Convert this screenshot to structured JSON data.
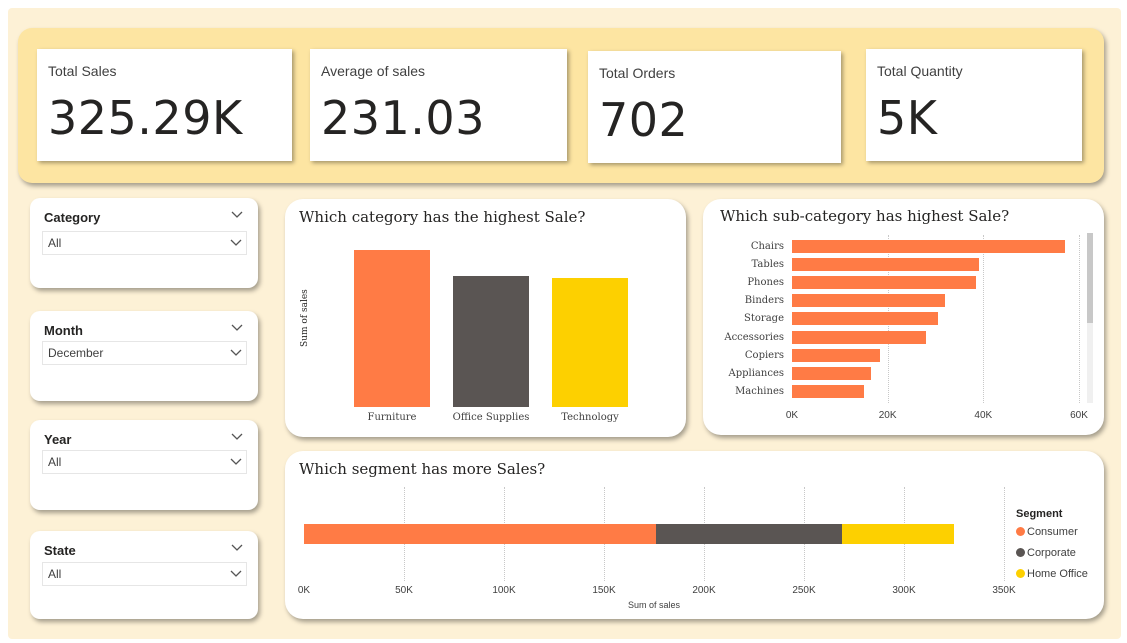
{
  "kpis": [
    {
      "label": "Total Sales",
      "value": "325.29K"
    },
    {
      "label": "Average of sales",
      "value": "231.03"
    },
    {
      "label": "Total Orders",
      "value": "702"
    },
    {
      "label": "Total Quantity",
      "value": "5K"
    }
  ],
  "slicers": [
    {
      "title": "Category",
      "value": "All"
    },
    {
      "title": "Month",
      "value": "December"
    },
    {
      "title": "Year",
      "value": "All"
    },
    {
      "title": "State",
      "value": "All"
    }
  ],
  "colors": {
    "orange": "#ff7b45",
    "dark": "#5a5553",
    "yellow": "#fdd000"
  },
  "chart_data": [
    {
      "type": "bar",
      "title": "Which category has the highest Sale?",
      "ylabel": "Sum of sales",
      "xlabel": "",
      "categories": [
        "Furniture",
        "Office Supplies",
        "Technology"
      ],
      "values": [
        118000,
        99000,
        97000
      ],
      "ylim": [
        0,
        125000
      ],
      "colors": [
        "#ff7b45",
        "#5a5553",
        "#fdd000"
      ]
    },
    {
      "type": "bar",
      "orientation": "horizontal",
      "title": "Which sub-category has highest Sale?",
      "categories": [
        "Chairs",
        "Tables",
        "Phones",
        "Binders",
        "Storage",
        "Accessories",
        "Copiers",
        "Appliances",
        "Machines"
      ],
      "values": [
        57000,
        39000,
        38500,
        32000,
        30500,
        28000,
        18500,
        16500,
        15000
      ],
      "xlim": [
        0,
        62000
      ],
      "ticks": [
        "0K",
        "20K",
        "40K",
        "60K"
      ],
      "tick_values": [
        0,
        20000,
        40000,
        60000
      ],
      "color": "#ff7b45"
    },
    {
      "type": "bar",
      "orientation": "horizontal-stacked",
      "title": "Which segment has more Sales?",
      "xlabel": "Sum of sales",
      "legend_title": "Segment",
      "series": [
        {
          "name": "Consumer",
          "value": 176000,
          "color": "#ff7b45"
        },
        {
          "name": "Corporate",
          "value": 93000,
          "color": "#5a5553"
        },
        {
          "name": "Home Office",
          "value": 56000,
          "color": "#fdd000"
        }
      ],
      "xlim": [
        0,
        350000
      ],
      "ticks": [
        "0K",
        "50K",
        "100K",
        "150K",
        "200K",
        "250K",
        "300K",
        "350K"
      ],
      "tick_values": [
        0,
        50000,
        100000,
        150000,
        200000,
        250000,
        300000,
        350000
      ],
      "legend_position": "right"
    }
  ]
}
